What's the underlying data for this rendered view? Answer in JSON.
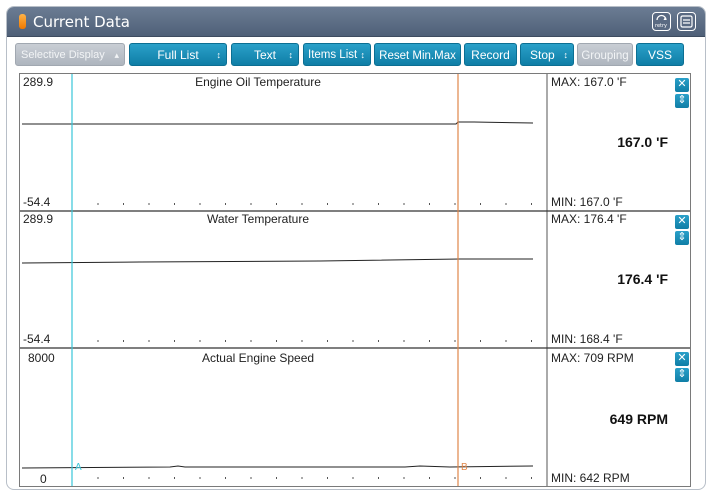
{
  "window": {
    "title": "Current Data"
  },
  "titlebar": {
    "retry_icon": "retry-icon",
    "retry_label": "retry",
    "save_icon": "save-icon"
  },
  "toolbar": {
    "selective_display": "Selective Display",
    "full_list": "Full List",
    "text": "Text",
    "items_list": "Items List",
    "reset_minmax": "Reset Min.Max",
    "record": "Record",
    "stop": "Stop",
    "grouping": "Grouping",
    "vss": "VSS"
  },
  "panels": [
    {
      "title": "Engine Oil Temperature",
      "ymax": "289.9",
      "ymin": "-54.4",
      "max_text": "MAX: 167.0 'F",
      "min_text": "MIN: 167.0 'F",
      "current": "167.0 'F"
    },
    {
      "title": "Water Temperature",
      "ymax": "289.9",
      "ymin": "-54.4",
      "max_text": "MAX: 176.4 'F",
      "min_text": "MIN: 168.4 'F",
      "current": "176.4 'F"
    },
    {
      "title": "Actual Engine Speed",
      "ymax": "8000",
      "ymin": "0",
      "max_text": "MAX:   709 RPM",
      "min_text": "MIN:   642 RPM",
      "current": "649 RPM"
    }
  ],
  "cursors": {
    "a_label": "A",
    "b_label": "B",
    "a_color": "#38c6d8",
    "b_color": "#e0874a"
  },
  "icons": {
    "close": "close-icon",
    "updown": "up-down-arrows-icon"
  }
}
